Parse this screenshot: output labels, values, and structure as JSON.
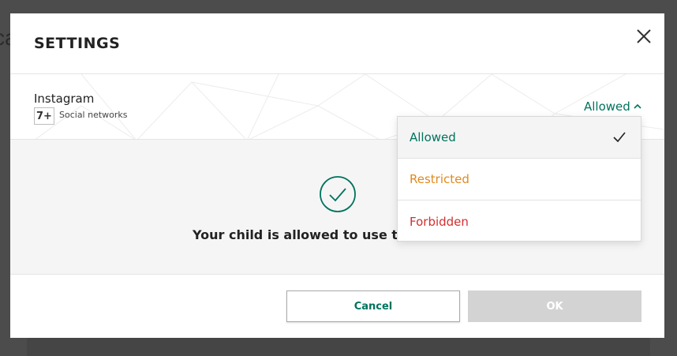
{
  "background": {
    "partial_text": "ca"
  },
  "modal": {
    "title": "SETTINGS",
    "close_icon": "close-icon"
  },
  "app": {
    "name": "Instagram",
    "age_rating": "7+",
    "category": "Social networks",
    "status": "Allowed",
    "status_icon": "chevron-up-icon"
  },
  "content": {
    "icon": "check-circle-icon",
    "message": "Your child is allowed to use the"
  },
  "dropdown": {
    "options": [
      {
        "label": "Allowed",
        "color": "#00735e",
        "selected": true
      },
      {
        "label": "Restricted",
        "color": "#e08a1e",
        "selected": false
      },
      {
        "label": "Forbidden",
        "color": "#d32f2f",
        "selected": false
      }
    ],
    "check_icon": "checkmark-icon"
  },
  "footer": {
    "cancel_label": "Cancel",
    "ok_label": "OK"
  },
  "colors": {
    "accent": "#00735e",
    "restricted": "#e08a1e",
    "forbidden": "#d32f2f",
    "disabled_button": "#d3d3d3"
  }
}
